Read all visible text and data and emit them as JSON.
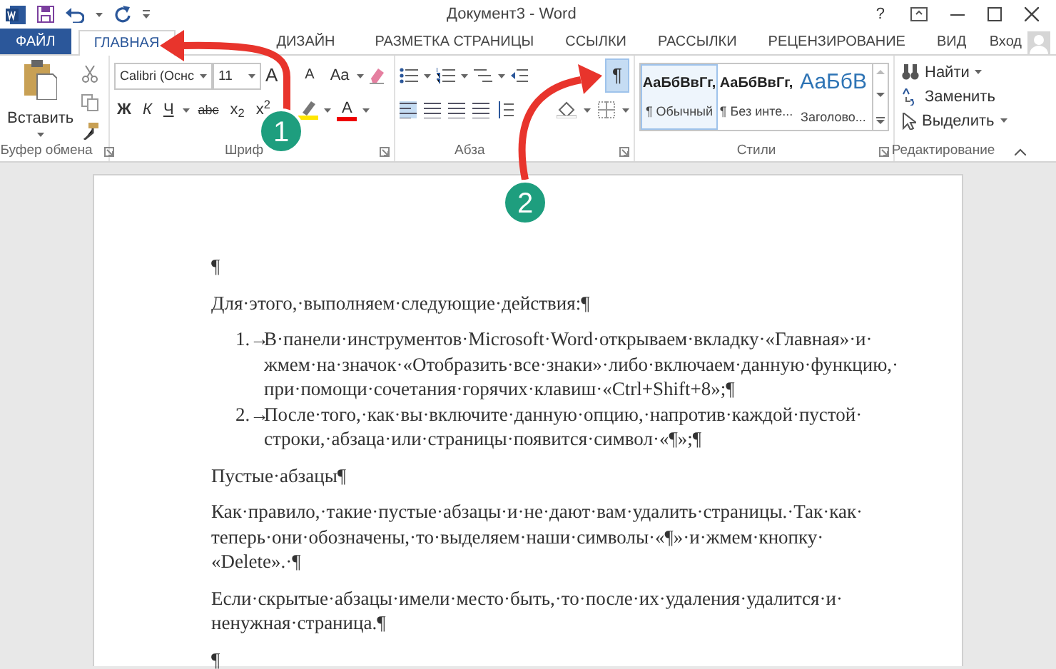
{
  "title_bar": {
    "title": "Документ3 - Word",
    "help": "?"
  },
  "tabs": [
    {
      "label": "ФАЙЛ",
      "kind": "file",
      "selected": false
    },
    {
      "label": "ГЛАВНАЯ",
      "kind": "tab",
      "selected": true
    },
    {
      "label": "ДИЗАЙН",
      "kind": "tab",
      "selected": false
    },
    {
      "label": "РАЗМЕТКА СТРАНИЦЫ",
      "kind": "tab",
      "selected": false
    },
    {
      "label": "ССЫЛКИ",
      "kind": "tab",
      "selected": false
    },
    {
      "label": "РАССЫЛКИ",
      "kind": "tab",
      "selected": false
    },
    {
      "label": "РЕЦЕНЗИРОВАНИЕ",
      "kind": "tab",
      "selected": false
    },
    {
      "label": "ВИД",
      "kind": "tab",
      "selected": false
    }
  ],
  "account": {
    "label": "Вход"
  },
  "clipboard": {
    "paste": "Вставить",
    "label": "Буфер обмена"
  },
  "font": {
    "name": "Calibri (Оснс",
    "size": "11",
    "grow": "A",
    "shrink": "A",
    "case": "Aa",
    "bold": "Ж",
    "italic": "К",
    "underline": "Ч",
    "strike": "abc",
    "subscript": "x$_{2}$",
    "superscript": "x$^{2}$",
    "font_color_letter": "А",
    "label": "Шриф"
  },
  "paragraph": {
    "show_marks": {
      "glyph": "¶",
      "on": true
    },
    "label": "Абза"
  },
  "styles": {
    "items": [
      {
        "preview": "АаБбВвГг,",
        "name": "¶ Обычный",
        "kind": "normal",
        "selected": true
      },
      {
        "preview": "АаБбВвГг,",
        "name": "¶ Без инте...",
        "kind": "normal",
        "selected": false
      },
      {
        "preview": "АаБбВ",
        "name": "Заголово...",
        "kind": "heading",
        "selected": false
      }
    ],
    "label": "Стили"
  },
  "editing": {
    "find": "Найти",
    "replace": "Заменить",
    "select": "Выделить",
    "label": "Редактирование"
  },
  "document": {
    "paragraphs": [
      {
        "kind": "plain",
        "lines": [
          "¶"
        ]
      },
      {
        "kind": "plain",
        "lines": [
          "Для·этого,·выполняем·следующие·действия:¶"
        ]
      },
      {
        "kind": "list",
        "number": "1.→",
        "lines": [
          "В·панели·инструментов·Microsoft·Word·открываем·вкладку·«Главная»·и·",
          "жмем·на·значок·«Отобразить·все·знаки»·либо·включаем·данную·функцию,·",
          "при·помощи·сочетания·горячих·клавиш·«Ctrl+Shift+8»;¶"
        ]
      },
      {
        "kind": "list",
        "number": "2.→",
        "lines": [
          "После·того,·как·вы·включите·данную·опцию,·напротив·каждой·пустой·",
          "строки,·абзаца·или·страницы·появится·символ·«¶»;¶"
        ]
      },
      {
        "kind": "plain",
        "lines": [
          "Пустые·абзацы¶"
        ]
      },
      {
        "kind": "plain",
        "lines": [
          "Как·правило,·такие·пустые·абзацы·и·не·дают·вам·удалить·страницы.·Так·как·",
          "теперь·они·обозначены,·то·выделяем·наши·символы·«¶»·и·жмем·кнопку·",
          "«Delete».·¶"
        ]
      },
      {
        "kind": "plain",
        "lines": [
          "Если·скрытые·абзацы·имели·место·быть,·то·после·их·удаления·удалится·и·",
          "ненужная·страница.¶"
        ]
      },
      {
        "kind": "plain",
        "lines": [
          "¶"
        ]
      }
    ]
  },
  "callouts": [
    {
      "label": "1"
    },
    {
      "label": "2"
    }
  ]
}
